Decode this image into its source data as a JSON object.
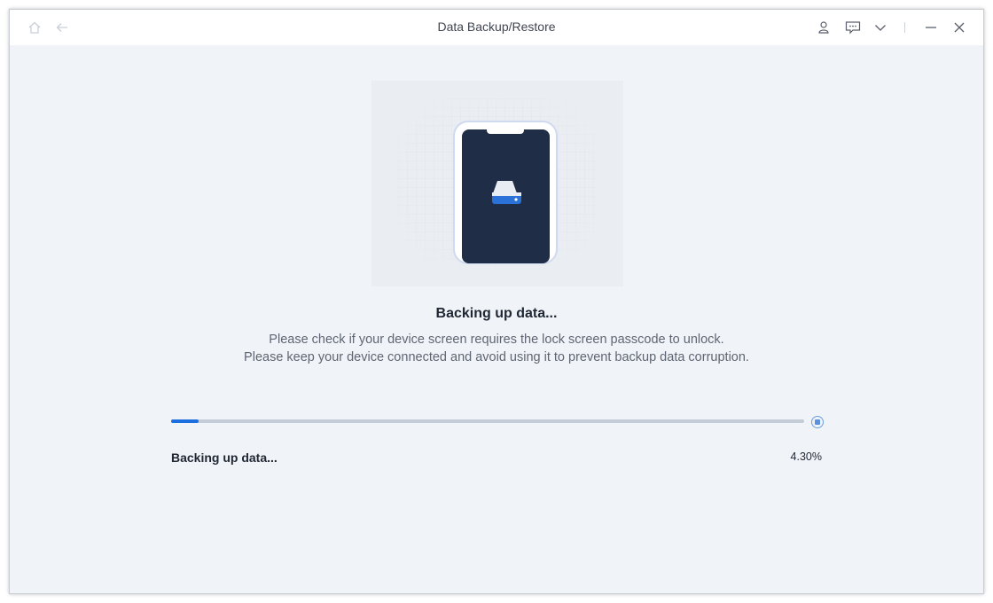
{
  "window": {
    "title": "Data Backup/Restore"
  },
  "titlebar": {
    "icons": [
      "home-icon",
      "back-arrow-icon",
      "user-icon",
      "feedback-icon",
      "chevron-down-icon",
      "minimize-icon",
      "close-icon"
    ]
  },
  "main": {
    "heading": "Backing up data...",
    "description_line1": "Please check if your device screen requires the lock screen passcode to unlock.",
    "description_line2": "Please keep your device connected and avoid using it to prevent backup data corruption.",
    "progress": {
      "fraction": 0.043,
      "status_label": "Backing up data...",
      "percent_text": "4.30%"
    }
  },
  "colors": {
    "accent": "#1d6fe0",
    "phone_screen": "#1f2d46",
    "background": "#f0f3f7"
  }
}
